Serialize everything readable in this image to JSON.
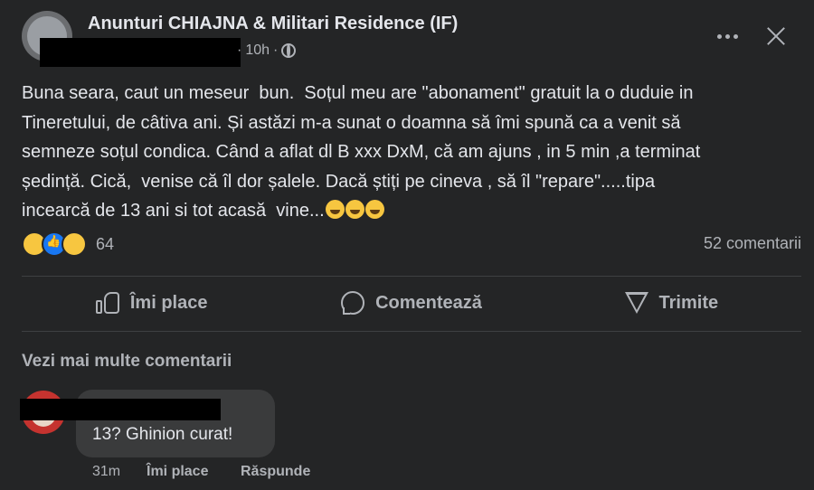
{
  "post": {
    "group_name": "Anunturi CHIAJNA & Militari Residence (IF)",
    "time": "10h",
    "separator": "·",
    "lines": [
      "Buna seara, caut un meseur  bun.  Soțul meu are \"abonament\" gratuit la o duduie in",
      "Tineretului, de câtiva ani. Și astăzi m-a sunat o doamna să îmi spună ca a venit să",
      "semneze soțul condica. Când a aflat dl B xxx DxM, că am ajuns , in 5 min ,a terminat",
      "ședință. Cică,  venise că îl dor șalele. Dacă știți pe cineva , să îl \"repare\".....tipa",
      "incearcă de 13 ani si tot acasă  vine..."
    ]
  },
  "reactions": {
    "count": "64",
    "comments": "52 comentarii",
    "types": [
      "haha-icon",
      "like-icon",
      "sad-icon"
    ]
  },
  "actions": {
    "like": "Îmi place",
    "comment": "Comentează",
    "share": "Trimite"
  },
  "comments": {
    "more": "Vezi mai multe comentarii",
    "items": [
      {
        "text": "13? Ghinion curat!",
        "time": "31m",
        "like": "Îmi place",
        "reply": "Răspunde"
      }
    ]
  },
  "colors": {
    "background": "#242526",
    "text": "#e4e6eb",
    "muted": "#b0b3b8",
    "bubble": "#3a3b3c"
  }
}
